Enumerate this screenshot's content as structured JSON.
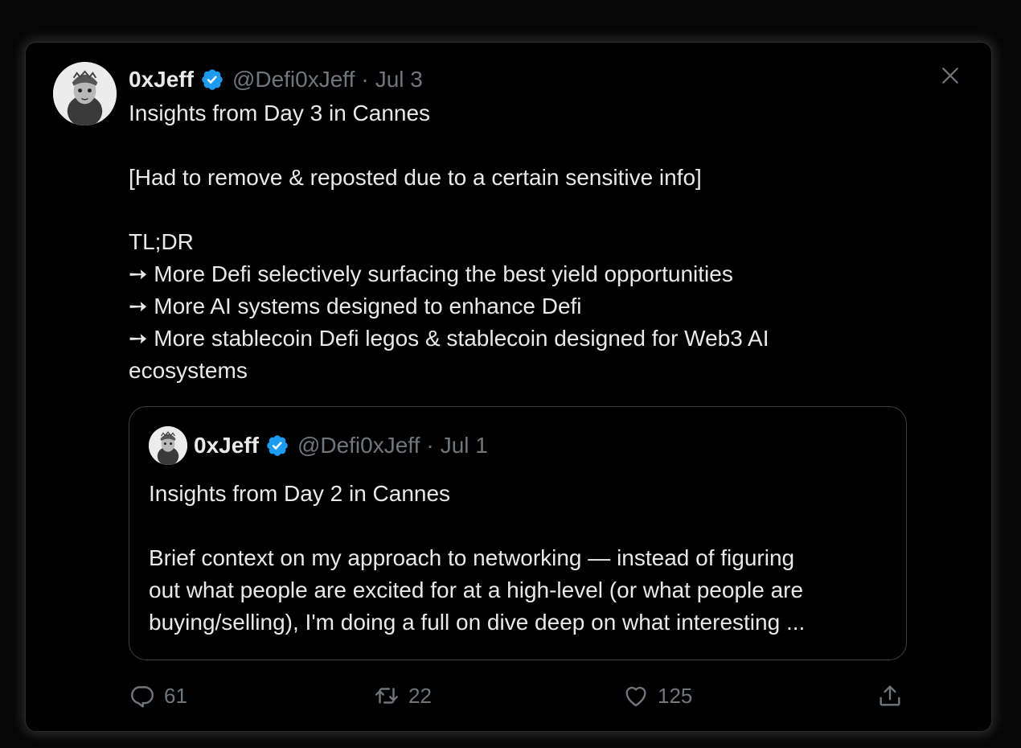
{
  "tweet": {
    "author_name": "0xJeff",
    "handle": "@Defi0xJeff",
    "separator": "·",
    "date": "Jul 3",
    "lines": {
      "l1": "Insights from Day 3 in Cannes",
      "l2": "[Had to remove & reposted due to a certain sensitive info]",
      "l3": "TL;DR",
      "l4": "➙ More Defi selectively surfacing the best yield opportunities",
      "l5": "➙ More AI systems designed to enhance Defi",
      "l6": "➙ More stablecoin Defi legos & stablecoin designed for Web3 AI",
      "l7": "ecosystems"
    }
  },
  "quoted_tweet": {
    "author_name": "0xJeff",
    "handle": "@Defi0xJeff",
    "separator": "·",
    "date": "Jul 1",
    "lines": {
      "l1": "Insights from Day 2 in Cannes",
      "l2": "Brief context on my approach to networking — instead of figuring",
      "l3": "out what people are excited for at a high-level (or what people are",
      "l4": "buying/selling), I'm doing a full on dive deep on what interesting ..."
    }
  },
  "actions": {
    "replies": "61",
    "reposts": "22",
    "likes": "125"
  },
  "icons": {
    "verified": "verified-badge-icon",
    "close": "close-icon",
    "reply": "reply-icon",
    "repost": "repost-icon",
    "like": "heart-icon",
    "share": "share-icon"
  },
  "colors": {
    "background": "#000000",
    "text": "#e7e9ea",
    "muted": "#71767b",
    "verified": "#1d9bf0",
    "border": "#3b3f44"
  }
}
